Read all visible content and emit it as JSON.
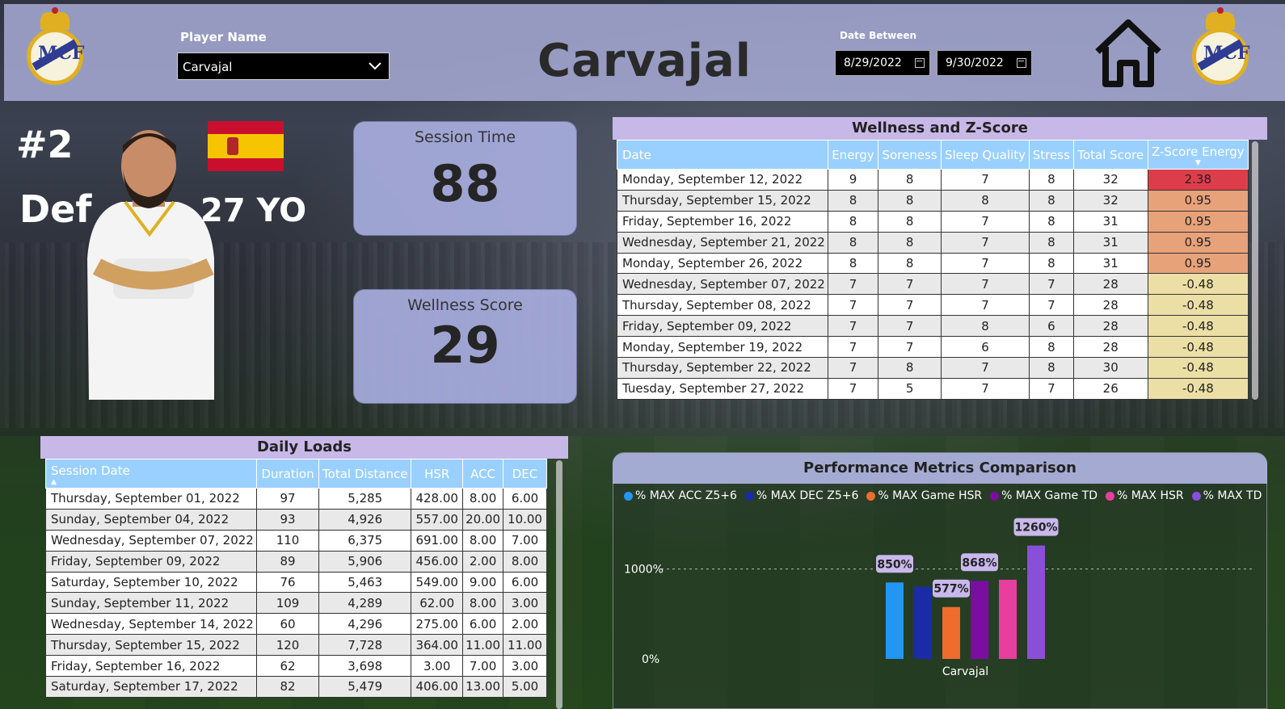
{
  "header": {
    "player_label": "Player Name",
    "player_value": "Carvajal",
    "title": "Carvajal",
    "date_label": "Date Between",
    "date_from": "8/29/2022",
    "date_to": "9/30/2022"
  },
  "profile": {
    "number": "#2",
    "position": "Def",
    "age": "27 YO"
  },
  "kpis": {
    "session_label": "Session Time",
    "session_value": "88",
    "wellness_label": "Wellness Score",
    "wellness_value": "29"
  },
  "wellness": {
    "title": "Wellness and Z-Score",
    "columns": [
      "Date",
      "Energy",
      "Soreness",
      "Sleep Quality",
      "Stress",
      "Total Score",
      "Z-Score Energy"
    ],
    "rows": [
      [
        "Monday, September 12, 2022",
        "9",
        "8",
        "7",
        "8",
        "32",
        "2.38"
      ],
      [
        "Thursday, September 15, 2022",
        "8",
        "8",
        "8",
        "8",
        "32",
        "0.95"
      ],
      [
        "Friday, September 16, 2022",
        "8",
        "8",
        "7",
        "8",
        "31",
        "0.95"
      ],
      [
        "Wednesday, September 21, 2022",
        "8",
        "8",
        "7",
        "8",
        "31",
        "0.95"
      ],
      [
        "Monday, September 26, 2022",
        "8",
        "8",
        "7",
        "8",
        "31",
        "0.95"
      ],
      [
        "Wednesday, September 07, 2022",
        "7",
        "7",
        "7",
        "7",
        "28",
        "-0.48"
      ],
      [
        "Thursday, September 08, 2022",
        "7",
        "7",
        "7",
        "7",
        "28",
        "-0.48"
      ],
      [
        "Friday, September 09, 2022",
        "7",
        "7",
        "8",
        "6",
        "28",
        "-0.48"
      ],
      [
        "Monday, September 19, 2022",
        "7",
        "7",
        "6",
        "8",
        "28",
        "-0.48"
      ],
      [
        "Thursday, September 22, 2022",
        "7",
        "8",
        "7",
        "8",
        "30",
        "-0.48"
      ],
      [
        "Tuesday, September 27, 2022",
        "7",
        "5",
        "7",
        "7",
        "26",
        "-0.48"
      ]
    ],
    "zcolors": {
      "high": "#dd3d4a",
      "mid": "#e8a27a",
      "low": "#ecdfa6"
    }
  },
  "daily": {
    "title": "Daily Loads",
    "columns": [
      "Session Date",
      "Duration",
      "Total Distance",
      "HSR",
      "ACC",
      "DEC"
    ],
    "rows": [
      [
        "Thursday, September 01, 2022",
        "97",
        "5,285",
        "428.00",
        "8.00",
        "6.00"
      ],
      [
        "Sunday, September 04, 2022",
        "93",
        "4,926",
        "557.00",
        "20.00",
        "10.00"
      ],
      [
        "Wednesday, September 07, 2022",
        "110",
        "6,375",
        "691.00",
        "8.00",
        "7.00"
      ],
      [
        "Friday, September 09, 2022",
        "89",
        "5,906",
        "456.00",
        "2.00",
        "8.00"
      ],
      [
        "Saturday, September 10, 2022",
        "76",
        "5,463",
        "549.00",
        "9.00",
        "6.00"
      ],
      [
        "Sunday, September 11, 2022",
        "109",
        "4,289",
        "62.00",
        "8.00",
        "3.00"
      ],
      [
        "Wednesday, September 14, 2022",
        "60",
        "4,296",
        "275.00",
        "6.00",
        "2.00"
      ],
      [
        "Thursday, September 15, 2022",
        "120",
        "7,728",
        "364.00",
        "11.00",
        "11.00"
      ],
      [
        "Friday, September 16, 2022",
        "62",
        "3,698",
        "3.00",
        "7.00",
        "3.00"
      ],
      [
        "Saturday, September 17, 2022",
        "82",
        "5,479",
        "406.00",
        "13.00",
        "5.00"
      ]
    ]
  },
  "chart_data": {
    "type": "bar",
    "title": "Performance Metrics Comparison",
    "categories": [
      "Carvajal"
    ],
    "ylim": [
      0,
      1400
    ],
    "yticks": [
      "1000%",
      "0%"
    ],
    "series": [
      {
        "name": "% MAX ACC Z5+6",
        "values": [
          850
        ],
        "color": "#2196f3",
        "label": "850%"
      },
      {
        "name": "% MAX DEC Z5+6",
        "values": [
          800
        ],
        "color": "#1a2ba8",
        "label": ""
      },
      {
        "name": "% MAX Game HSR",
        "values": [
          577
        ],
        "color": "#ef6c2d",
        "label": "577%"
      },
      {
        "name": "% MAX Game TD",
        "values": [
          868
        ],
        "color": "#7a0ea0",
        "label": "868%"
      },
      {
        "name": "% MAX HSR",
        "values": [
          880
        ],
        "color": "#e83e9e",
        "label": ""
      },
      {
        "name": "% MAX TD",
        "values": [
          1260
        ],
        "color": "#8a4fd8",
        "label": "1260%"
      }
    ]
  }
}
